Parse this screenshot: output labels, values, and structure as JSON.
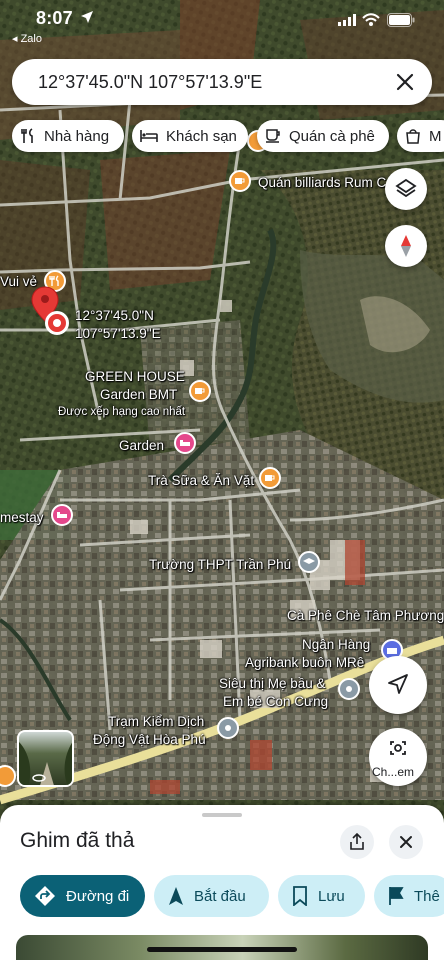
{
  "status_bar": {
    "time": "8:07",
    "back_label": "◂ Zalo"
  },
  "search": {
    "query": "12°37'45.0\"N 107°57'13.9\"E"
  },
  "chips": [
    {
      "label": "Nhà hàng",
      "icon": "restaurant-icon"
    },
    {
      "label": "Khách sạn",
      "icon": "hotel-icon"
    },
    {
      "label": "Quán cà phê",
      "icon": "coffee-icon"
    },
    {
      "label": "M",
      "icon": "shopping-bag-icon"
    }
  ],
  "map_labels": {
    "dropped_pin_line1": "12°37'45.0\"N",
    "dropped_pin_line2": "107°57'13.9\"E",
    "vui_ve": "Vui vẻ",
    "quan_billiards": "Quán billiards Rum C",
    "green_house_line1": "GREEN HOUSE",
    "green_house_line2": "Garden BMT",
    "green_house_note": "Được xếp hạng cao nhất",
    "garden": "Garden",
    "tra_sua": "Trà Sữa & Ăn Vặt",
    "homestay": "mestay",
    "truong_thpt": "Trường THPT Trần Phú",
    "ca_phe_che": "Cà Phê Chè Tâm Phương",
    "ngan_hang_line1": "Ngân Hàng",
    "ngan_hang_line2": "Agribank buôn MRê",
    "sieu_thi_line1": "Siêu thị Mẹ bầu &",
    "sieu_thi_line2": "Em bé Con Cưng",
    "tram_kiem_dich_line1": "Trạm Kiểm Dịch",
    "tram_kiem_dich_line2": "Động Vật Hòa Phú"
  },
  "controls": {
    "lens_label": "Ch...em"
  },
  "sheet": {
    "title": "Ghim đã thả",
    "actions": [
      {
        "label": "Đường đi",
        "icon": "directions-icon"
      },
      {
        "label": "Bắt đầu",
        "icon": "navigation-arrow-icon"
      },
      {
        "label": "Lưu",
        "icon": "bookmark-icon"
      },
      {
        "label": "Thê",
        "icon": "flag-icon"
      }
    ]
  },
  "colors": {
    "primary_button": "#0b6176",
    "secondary_button": "#cdeef6",
    "pin_red": "#e53935",
    "poi_orange": "#f29b38",
    "poi_pink": "#e4488b",
    "poi_gray": "#8a9aa5",
    "poi_blue": "#5b6ee1"
  }
}
